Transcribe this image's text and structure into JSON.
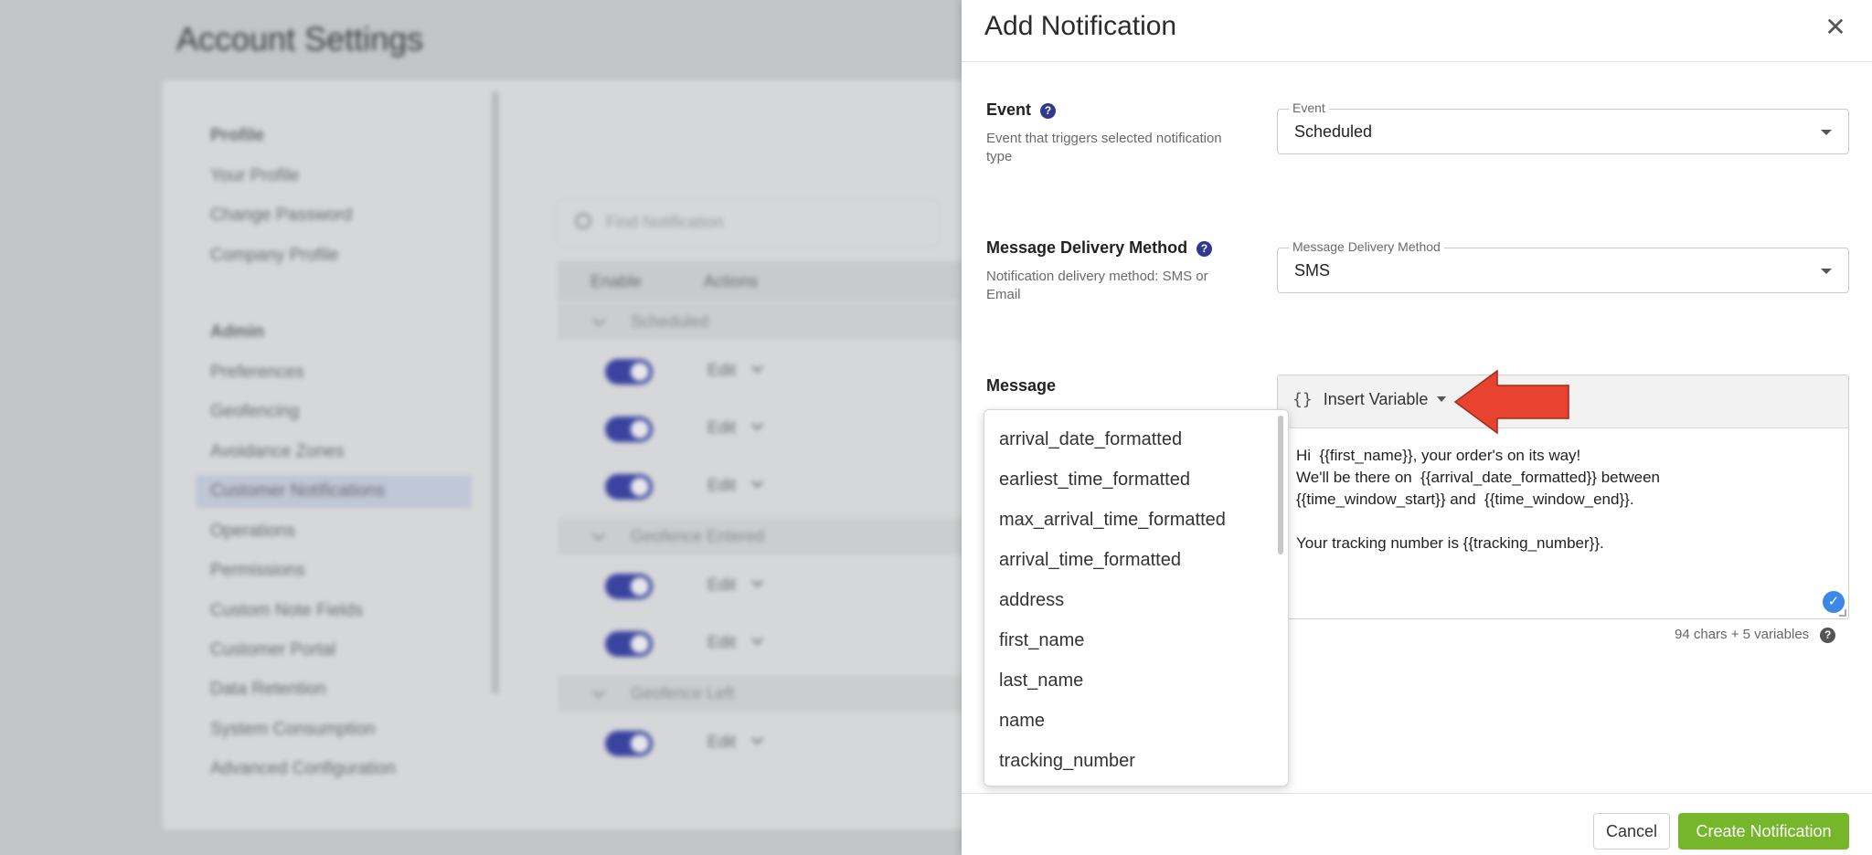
{
  "background": {
    "page_title": "Account Settings",
    "sidebar": {
      "group_profile": "Profile",
      "profile_items": [
        "Your Profile",
        "Change Password",
        "Company Profile"
      ],
      "group_admin": "Admin",
      "admin_items": [
        "Preferences",
        "Geofencing",
        "Avoidance Zones",
        "Customer Notifications",
        "Operations",
        "Permissions",
        "Custom Note Fields",
        "Customer Portal",
        "Data Retention",
        "System Consumption",
        "Advanced Configuration"
      ]
    },
    "search_placeholder": "Find Notification",
    "table": {
      "headers": [
        "Enable",
        "Actions"
      ],
      "groups": [
        "Scheduled",
        "Geofence Entered",
        "Geofence Left"
      ],
      "action_label": "Edit"
    }
  },
  "drawer": {
    "title": "Add Notification",
    "event": {
      "label": "Event",
      "description": "Event that triggers selected notification type",
      "field_legend": "Event",
      "value": "Scheduled"
    },
    "delivery": {
      "label": "Message Delivery Method",
      "description": "Notification delivery method: SMS or Email",
      "field_legend": "Message Delivery Method",
      "value": "SMS"
    },
    "message": {
      "label": "Message",
      "insert_variable": "Insert Variable",
      "lines": [
        "Hi  {{first_name}}, your order's on its way!",
        "We'll be there on  {{arrival_date_formatted}} between",
        "{{time_window_start}} and  {{time_window_end}}.",
        "",
        "Your tracking number is {{tracking_number}}."
      ],
      "counter": "94 chars + 5 variables"
    },
    "variables": [
      "arrival_date_formatted",
      "earliest_time_formatted",
      "max_arrival_time_formatted",
      "arrival_time_formatted",
      "address",
      "first_name",
      "last_name",
      "name",
      "tracking_number"
    ],
    "buttons": {
      "cancel": "Cancel",
      "create": "Create Notification"
    }
  },
  "colors": {
    "accent_green": "#76b62b",
    "help_icon": "#2f3a8f",
    "arrow_red": "#e8432e",
    "check_blue": "#3d87e6"
  }
}
